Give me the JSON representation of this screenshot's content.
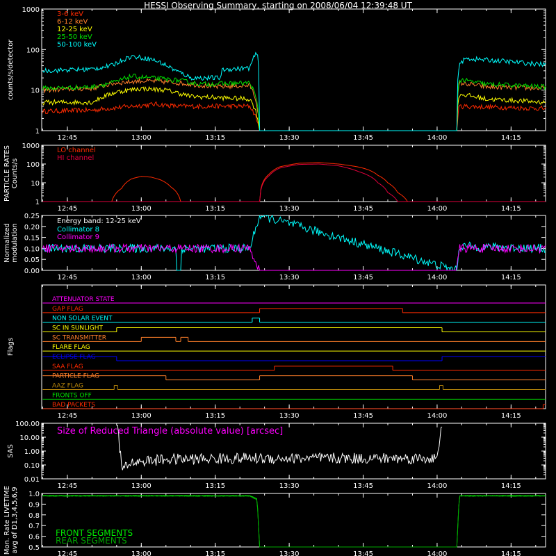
{
  "title": "HESSI Observing Summary, starting on 2008/06/04 12:39:48 UT",
  "colors": {
    "background": "#000000",
    "axes": "#ffffff",
    "red": "#ff2a00",
    "orange": "#ff7f2a",
    "yellow": "#ffff00",
    "green": "#00e000",
    "cyan": "#00ffff",
    "magenta": "#ff00ff",
    "blue": "#0000ff",
    "crimson": "#e0003c",
    "dkgreen": "#00bb00"
  },
  "time_axis": {
    "tick_labels": [
      "12:45",
      "13:00",
      "13:15",
      "13:30",
      "13:45",
      "14:00",
      "14:15"
    ],
    "tick_minutes": [
      45,
      60,
      75,
      90,
      105,
      120,
      135
    ],
    "start_minutes": 39.8,
    "end_minutes": 142
  },
  "chart_data": [
    {
      "id": "count-rates",
      "type": "line",
      "ylabel": "counts/s/detector",
      "yscale": "log",
      "ylim": [
        1,
        1000
      ],
      "y_tick_labels": [
        "1",
        "10",
        "100",
        "1000"
      ],
      "y_tick_values": [
        1,
        10,
        100,
        1000
      ],
      "series": [
        {
          "name": "3-6 keV",
          "color": "#ff2a00",
          "x": [
            40,
            50,
            58,
            63,
            67,
            82,
            84,
            124,
            124.5,
            142
          ],
          "y": [
            3,
            3.2,
            4,
            4.5,
            4,
            4,
            1,
            1,
            4,
            3.5
          ]
        },
        {
          "name": "6-12 keV",
          "color": "#ff7f2a",
          "x": [
            40,
            50,
            55,
            60,
            65,
            70,
            75,
            82,
            84,
            124,
            124.5,
            130,
            142
          ],
          "y": [
            10,
            11,
            15,
            17,
            16,
            14,
            12,
            13,
            1,
            1,
            15,
            12,
            11
          ]
        },
        {
          "name": "12-25 keV",
          "color": "#ffff00",
          "x": [
            40,
            50,
            55,
            60,
            65,
            70,
            82,
            84,
            124,
            124.5,
            130,
            142
          ],
          "y": [
            5,
            5,
            9,
            11,
            10,
            7,
            6,
            1,
            1,
            8,
            6,
            5
          ]
        },
        {
          "name": "25-50 keV",
          "color": "#00e000",
          "x": [
            40,
            50,
            55,
            58,
            62,
            68,
            72,
            82,
            84,
            124,
            124.5,
            130,
            142
          ],
          "y": [
            11,
            12,
            16,
            22,
            20,
            17,
            14,
            15,
            1,
            1,
            18,
            14,
            12
          ]
        },
        {
          "name": "50-100 keV",
          "color": "#00ffff",
          "x": [
            40,
            50,
            54,
            58,
            62,
            67,
            70,
            76,
            76.5,
            82,
            83.5,
            84,
            124,
            124.5,
            126,
            142
          ],
          "y": [
            30,
            33,
            40,
            68,
            58,
            30,
            20,
            20,
            32,
            35,
            85,
            1,
            1,
            45,
            60,
            42
          ]
        }
      ]
    },
    {
      "id": "particle-rates",
      "type": "line",
      "ylabel": "PARTICLE RATES",
      "ylabel2": "Counts/s",
      "yscale": "log",
      "ylim": [
        1,
        1000
      ],
      "y_tick_labels": [
        "1",
        "10",
        "100",
        "1000"
      ],
      "y_tick_values": [
        1,
        10,
        100,
        1000
      ],
      "series": [
        {
          "name": "LO channel",
          "color": "#ff2a00",
          "x": [
            40,
            54,
            56,
            58,
            60,
            62,
            64,
            66,
            68,
            84,
            86,
            88,
            92,
            96,
            100,
            104,
            106,
            108,
            110,
            112,
            114,
            142
          ],
          "y": [
            1,
            1,
            5,
            16,
            22,
            20,
            14,
            6,
            1,
            1,
            30,
            70,
            110,
            120,
            100,
            70,
            50,
            25,
            10,
            3,
            1,
            1
          ]
        },
        {
          "name": "HI channel",
          "color": "#e0003c",
          "x": [
            40,
            84,
            86,
            88,
            92,
            96,
            100,
            104,
            108,
            110,
            112,
            142
          ],
          "y": [
            1,
            1,
            25,
            60,
            95,
            100,
            80,
            40,
            10,
            3,
            1,
            1
          ]
        }
      ]
    },
    {
      "id": "modulation",
      "type": "line",
      "ylabel": "Normalized",
      "ylabel2": "modulation",
      "yscale": "linear",
      "ylim": [
        0,
        0.25
      ],
      "y_tick_labels": [
        "0.00",
        "0.05",
        "0.10",
        "0.15",
        "0.20",
        "0.25"
      ],
      "y_tick_values": [
        0,
        0.05,
        0.1,
        0.15,
        0.2,
        0.25
      ],
      "annotation": "Energy band: 12-25 keV",
      "series": [
        {
          "name": "Collimator 8",
          "color": "#00ffff",
          "x": [
            40,
            67,
            67.2,
            68,
            68.2,
            82,
            84,
            124,
            124.5,
            142
          ],
          "y": [
            0.1,
            0.1,
            0,
            0,
            0.1,
            0.1,
            0.25,
            0,
            0.11,
            0.1
          ]
        },
        {
          "name": "Collimator 9",
          "color": "#ff00ff",
          "x": [
            40,
            82,
            84,
            124,
            124.5,
            142
          ],
          "y": [
            0.1,
            0.1,
            0,
            0,
            0.1,
            0.1
          ]
        }
      ]
    },
    {
      "id": "flags",
      "type": "line",
      "ylabel": "Flags",
      "flags": [
        {
          "name": "ATTENUATOR STATE",
          "color": "#ff00ff",
          "segments": [
            [
              40,
              142,
              0
            ]
          ]
        },
        {
          "name": "GAP FLAG",
          "color": "#ff2a00",
          "segments": [
            [
              40,
              84,
              0
            ],
            [
              84,
              113,
              1
            ],
            [
              113,
              142,
              0
            ]
          ]
        },
        {
          "name": "NON SOLAR EVENT",
          "color": "#00ffff",
          "segments": [
            [
              40,
              82.5,
              0
            ],
            [
              82.5,
              84,
              1
            ],
            [
              84,
              142,
              0
            ]
          ]
        },
        {
          "name": "SC IN SUNLIGHT",
          "color": "#ffff00",
          "segments": [
            [
              40,
              55,
              0
            ],
            [
              55,
              121,
              1
            ],
            [
              121,
              142,
              0
            ]
          ]
        },
        {
          "name": "SC TRANSMITTER",
          "color": "#ff7f2a",
          "segments": [
            [
              40,
              60,
              0
            ],
            [
              60,
              67,
              1
            ],
            [
              67,
              68,
              0
            ],
            [
              68,
              69.5,
              1
            ],
            [
              69.5,
              142,
              0
            ]
          ]
        },
        {
          "name": "FLARE FLAG",
          "color": "#ffff00",
          "segments": [
            [
              40,
              142,
              0
            ]
          ]
        },
        {
          "name": "ECLIPSE FLAG",
          "color": "#0000ff",
          "segments": [
            [
              40,
              55,
              1
            ],
            [
              55,
              121,
              0
            ],
            [
              121,
              142,
              1
            ]
          ]
        },
        {
          "name": "SAA FLAG",
          "color": "#ff2a00",
          "segments": [
            [
              40,
              87,
              0
            ],
            [
              87,
              111,
              1
            ],
            [
              111,
              142,
              0
            ]
          ]
        },
        {
          "name": "PARTICLE FLAG",
          "color": "#ff7f2a",
          "segments": [
            [
              40,
              65,
              1
            ],
            [
              65,
              84,
              0
            ],
            [
              84,
              115,
              1
            ],
            [
              115,
              142,
              0
            ]
          ]
        },
        {
          "name": "AAZ FLAG",
          "color": "#b8860b",
          "segments": [
            [
              40,
              54.5,
              0
            ],
            [
              54.5,
              55.2,
              1
            ],
            [
              55.2,
              120.5,
              0
            ],
            [
              120.5,
              121.2,
              1
            ],
            [
              121.2,
              142,
              0
            ]
          ]
        },
        {
          "name": "FRONTS OFF",
          "color": "#00e000",
          "segments": [
            [
              40,
              142,
              0
            ]
          ]
        },
        {
          "name": "BAD PACKETS",
          "color": "#ff2a00",
          "segments": [
            [
              40,
              141.5,
              0
            ],
            [
              141.5,
              142,
              1
            ]
          ]
        }
      ]
    },
    {
      "id": "sas",
      "type": "line",
      "ylabel": "SAS",
      "yscale": "log",
      "ylim": [
        0.01,
        100
      ],
      "y_tick_labels": [
        "0.01",
        "0.10",
        "1.00",
        "10.00",
        "100.00"
      ],
      "y_tick_values": [
        0.01,
        0.1,
        1,
        10,
        100
      ],
      "annotation": "Size of Reduced Triangle (absolute value) [arcsec]",
      "series": [
        {
          "name": "",
          "color": "#ffffff",
          "x": [
            55,
            55.5,
            56,
            58,
            65,
            80,
            100,
            120,
            120.5,
            121
          ],
          "y": [
            100,
            1,
            0.04,
            0.15,
            0.25,
            0.3,
            0.3,
            0.3,
            1,
            100
          ]
        }
      ]
    },
    {
      "id": "livetime",
      "type": "line",
      "ylabel": "Mon. Rate LIVETIME",
      "ylabel2": "avg of D1,3,4,5,6,9",
      "yscale": "linear",
      "ylim": [
        0.5,
        1.0
      ],
      "y_tick_labels": [
        "0.5",
        "0.6",
        "0.7",
        "0.8",
        "0.9",
        "1.0"
      ],
      "y_tick_values": [
        0.5,
        0.6,
        0.7,
        0.8,
        0.9,
        1.0
      ],
      "series": [
        {
          "name": "FRONT SEGMENTS",
          "color": "#00ee00",
          "x": [
            40,
            82,
            83.5,
            84,
            124,
            124.5,
            142
          ],
          "y": [
            0.98,
            0.98,
            0.95,
            0.5,
            0.5,
            0.98,
            0.98
          ]
        },
        {
          "name": "REAR SEGMENTS",
          "color": "#00aa00",
          "x": [
            40,
            82,
            83.5,
            84,
            124,
            124.5,
            142
          ],
          "y": [
            0.975,
            0.975,
            0.94,
            0.5,
            0.5,
            0.975,
            0.975
          ]
        }
      ]
    }
  ]
}
